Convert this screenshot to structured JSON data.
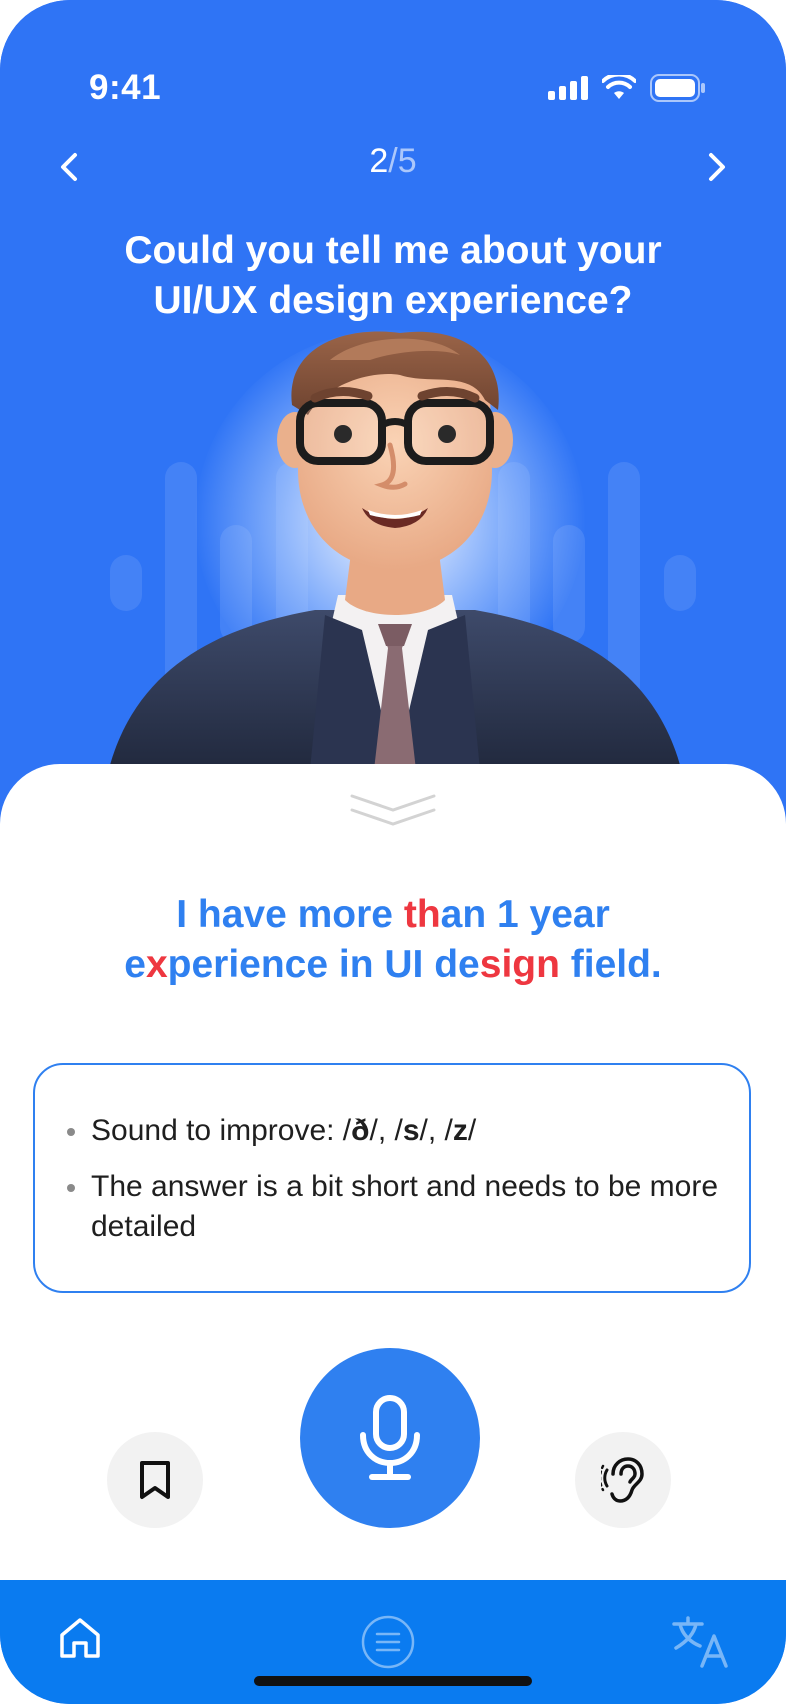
{
  "status_bar": {
    "time": "9:41"
  },
  "header": {
    "current": "2",
    "separator": "/",
    "total": "5",
    "question_line1": "Could you tell me about your",
    "question_line2": "UI/UX design experience?"
  },
  "answer": {
    "line1": [
      {
        "text": "I have more ",
        "error": false
      },
      {
        "text": "th",
        "error": true
      },
      {
        "text": "an 1 year",
        "error": false
      }
    ],
    "line2": [
      {
        "text": "e",
        "error": false
      },
      {
        "text": "x",
        "error": true
      },
      {
        "text": "perience in UI de",
        "error": false
      },
      {
        "text": "sign",
        "error": true
      },
      {
        "text": " field.",
        "error": false
      }
    ]
  },
  "feedback": {
    "item1_prefix": "Sound to improve: /",
    "sound1": "ð",
    "sep1": "/, /",
    "sound2": "s",
    "sep2": "/, /",
    "sound3": "z",
    "suffix": "/",
    "item2": "The answer is a bit short and needs to be more detailed"
  },
  "actions": {
    "bookmark_icon": "bookmark-icon",
    "mic_icon": "microphone-icon",
    "listen_icon": "ear-icon"
  },
  "tabbar": {
    "home_icon": "home-icon",
    "menu_icon": "menu-icon",
    "translate_icon": "translate-icon"
  },
  "colors": {
    "primary": "#2F74F5",
    "answer_blue": "#2F80F0",
    "error_red": "#EE3740",
    "tabbar": "#0A7BF0"
  }
}
